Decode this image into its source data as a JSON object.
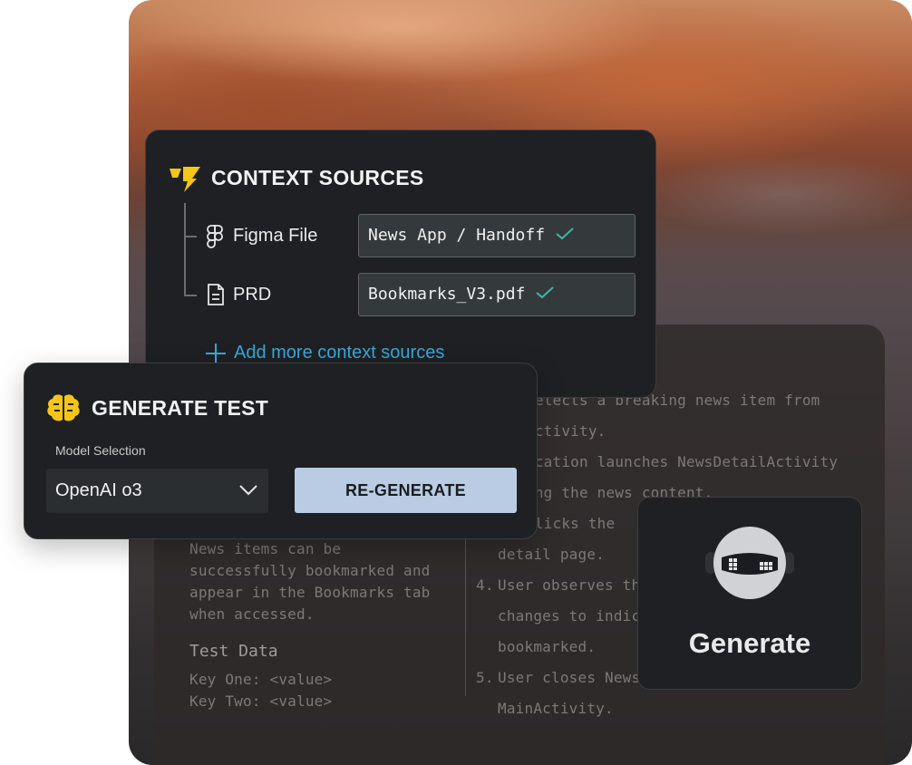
{
  "context_sources": {
    "title": "CONTEXT SOURCES",
    "items": [
      {
        "icon": "figma-icon",
        "label": "Figma File",
        "value": "News App / Handoff"
      },
      {
        "icon": "document-icon",
        "label": "PRD",
        "value": "Bookmarks_V3.pdf"
      }
    ],
    "add_more": "Add more context sources"
  },
  "generate_test": {
    "title": "GENERATE TEST",
    "model_label": "Model Selection",
    "model_value": "OpenAI o3",
    "regen_label": "RE-GENERATE"
  },
  "robot_card": {
    "label": "Generate"
  },
  "test_doc": {
    "steps_visible": [
      "selects a breaking news item from",
      "Activity.",
      "ication launches NewsDetailActivity",
      "ing the news content.",
      "clicks the",
      "detail page.",
      "4.",
      "User observes th",
      "changes to indic",
      "bookmarked.",
      "5.",
      "User closes News",
      "MainActivity."
    ],
    "expected_lines": [
      "News items can be",
      "successfully bookmarked and",
      "appear in the Bookmarks tab",
      "when accessed."
    ],
    "test_data_heading": "Test Data",
    "test_data_lines": [
      "Key One: <value>",
      "Key Two: <value>"
    ]
  },
  "colors": {
    "accent_yellow": "#f5c518",
    "link_blue": "#3aa8d8",
    "check_teal": "#3bb8a8",
    "button_bg": "#b9cce4",
    "card_bg": "#1e2023"
  }
}
